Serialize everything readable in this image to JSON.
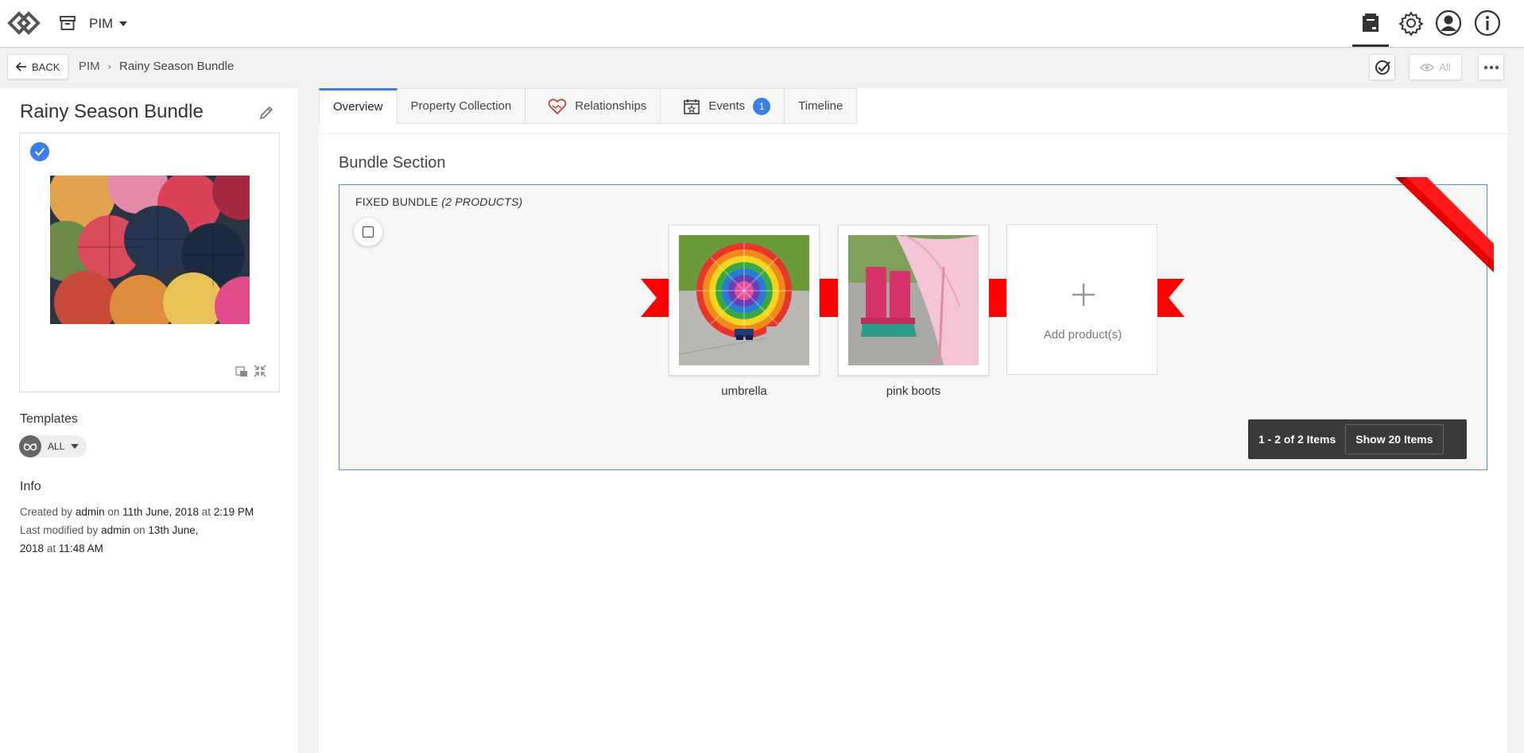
{
  "topbar": {
    "module_label": "PIM",
    "icons": [
      "logo-icon",
      "archive-icon",
      "catalog-icon",
      "gear-icon",
      "user-icon",
      "info-icon"
    ]
  },
  "subbar": {
    "back_label": "BACK",
    "breadcrumb": [
      "PIM",
      "Rainy Season Bundle"
    ],
    "view_label": "All"
  },
  "product": {
    "title": "Rainy Season Bundle",
    "templates_label": "Templates",
    "template_value": "ALL",
    "info_label": "Info",
    "created_prefix": "Created by",
    "created_user": "admin",
    "created_on": "on",
    "created_date": "11th June, 2018",
    "created_at": "at",
    "created_time": "2:19 PM",
    "modified_prefix": "Last modified by",
    "modified_user": "admin",
    "modified_on": "on",
    "modified_date_1": "13th June,",
    "modified_date_2": "2018",
    "modified_at": "at",
    "modified_time": "11:48 AM"
  },
  "tabs": [
    {
      "label": "Overview",
      "active": true
    },
    {
      "label": "Property Collection"
    },
    {
      "label": "Relationships"
    },
    {
      "label": "Events",
      "badge": "1"
    },
    {
      "label": "Timeline"
    }
  ],
  "bundle": {
    "section_title": "Bundle Section",
    "type_label": "FIXED BUNDLE",
    "count_label": "(2 PRODUCTS)",
    "products": [
      {
        "name": "umbrella"
      },
      {
        "name": "pink boots"
      }
    ],
    "add_label": "Add product(s)",
    "pager_count": "1 - 2 of 2 Items",
    "pager_show": "Show 20 Items"
  },
  "colors": {
    "accent": "#3a7ee8",
    "ribbon": "#ff0000",
    "pager_bg": "#3a3a3a"
  }
}
